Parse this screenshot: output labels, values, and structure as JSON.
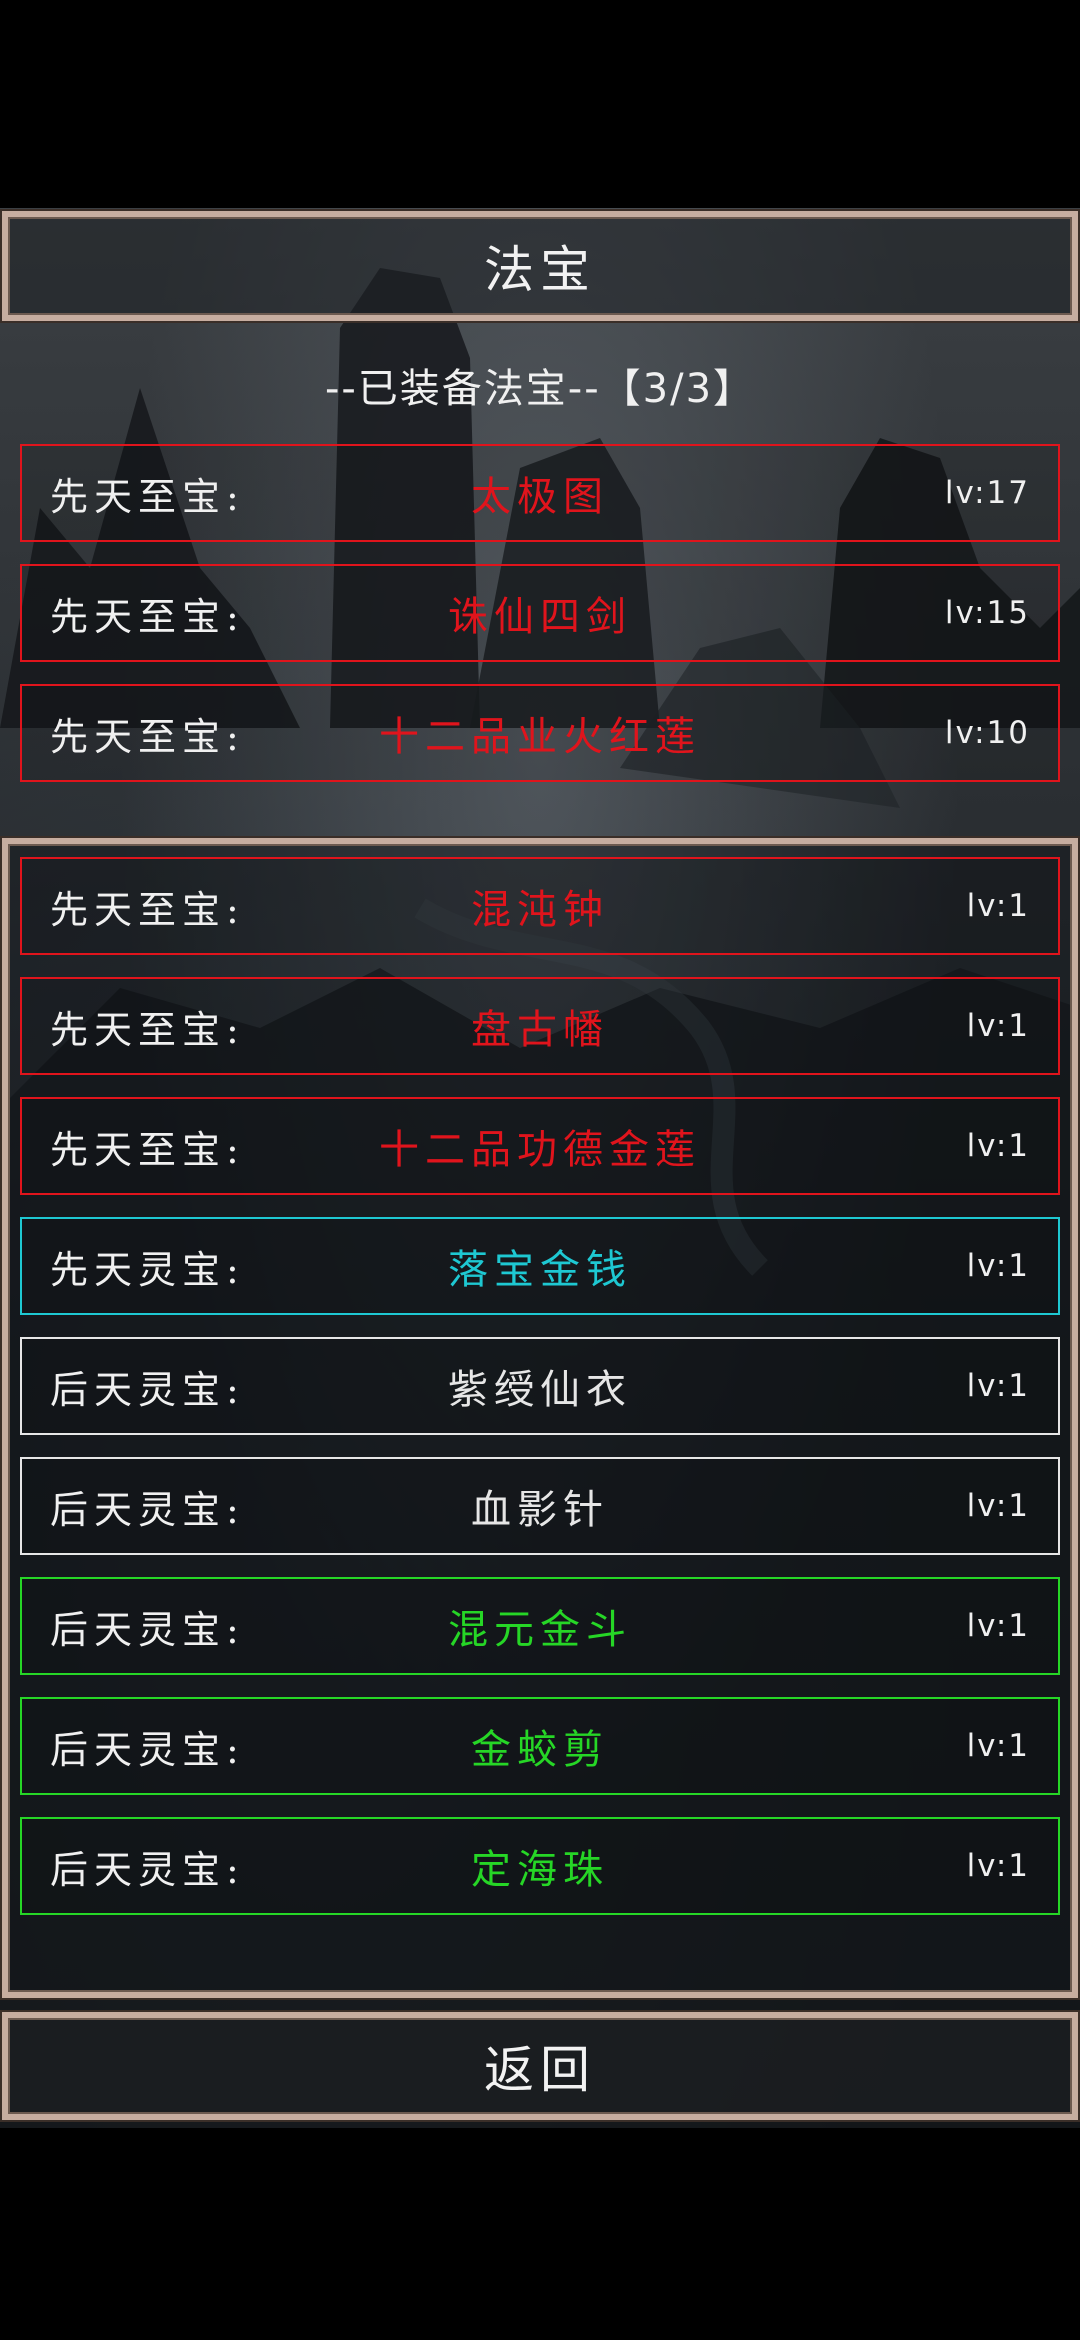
{
  "title": "法宝",
  "equipped_header": "--已装备法宝--【3/3】",
  "colors": {
    "red": "#e0141c",
    "cyan": "#1ec8d2",
    "white": "#e6e6e6",
    "green": "#26d626",
    "frame": "#c6ada0"
  },
  "equipped": [
    {
      "category": "先天至宝:",
      "name": "太极图",
      "level": "lv:17",
      "color": "red"
    },
    {
      "category": "先天至宝:",
      "name": "诛仙四剑",
      "level": "lv:15",
      "color": "red"
    },
    {
      "category": "先天至宝:",
      "name": "十二品业火红莲",
      "level": "lv:10",
      "color": "red"
    }
  ],
  "inventory": [
    {
      "category": "先天至宝:",
      "name": "混沌钟",
      "level": "lv:1",
      "color": "red"
    },
    {
      "category": "先天至宝:",
      "name": "盘古幡",
      "level": "lv:1",
      "color": "red"
    },
    {
      "category": "先天至宝:",
      "name": "十二品功德金莲",
      "level": "lv:1",
      "color": "red"
    },
    {
      "category": "先天灵宝:",
      "name": "落宝金钱",
      "level": "lv:1",
      "color": "cyan"
    },
    {
      "category": "后天灵宝:",
      "name": "紫绶仙衣",
      "level": "lv:1",
      "color": "white"
    },
    {
      "category": "后天灵宝:",
      "name": "血影针",
      "level": "lv:1",
      "color": "white"
    },
    {
      "category": "后天灵宝:",
      "name": "混元金斗",
      "level": "lv:1",
      "color": "green"
    },
    {
      "category": "后天灵宝:",
      "name": "金蛟剪",
      "level": "lv:1",
      "color": "green"
    },
    {
      "category": "后天灵宝:",
      "name": "定海珠",
      "level": "lv:1",
      "color": "green"
    }
  ],
  "back_label": "返回"
}
